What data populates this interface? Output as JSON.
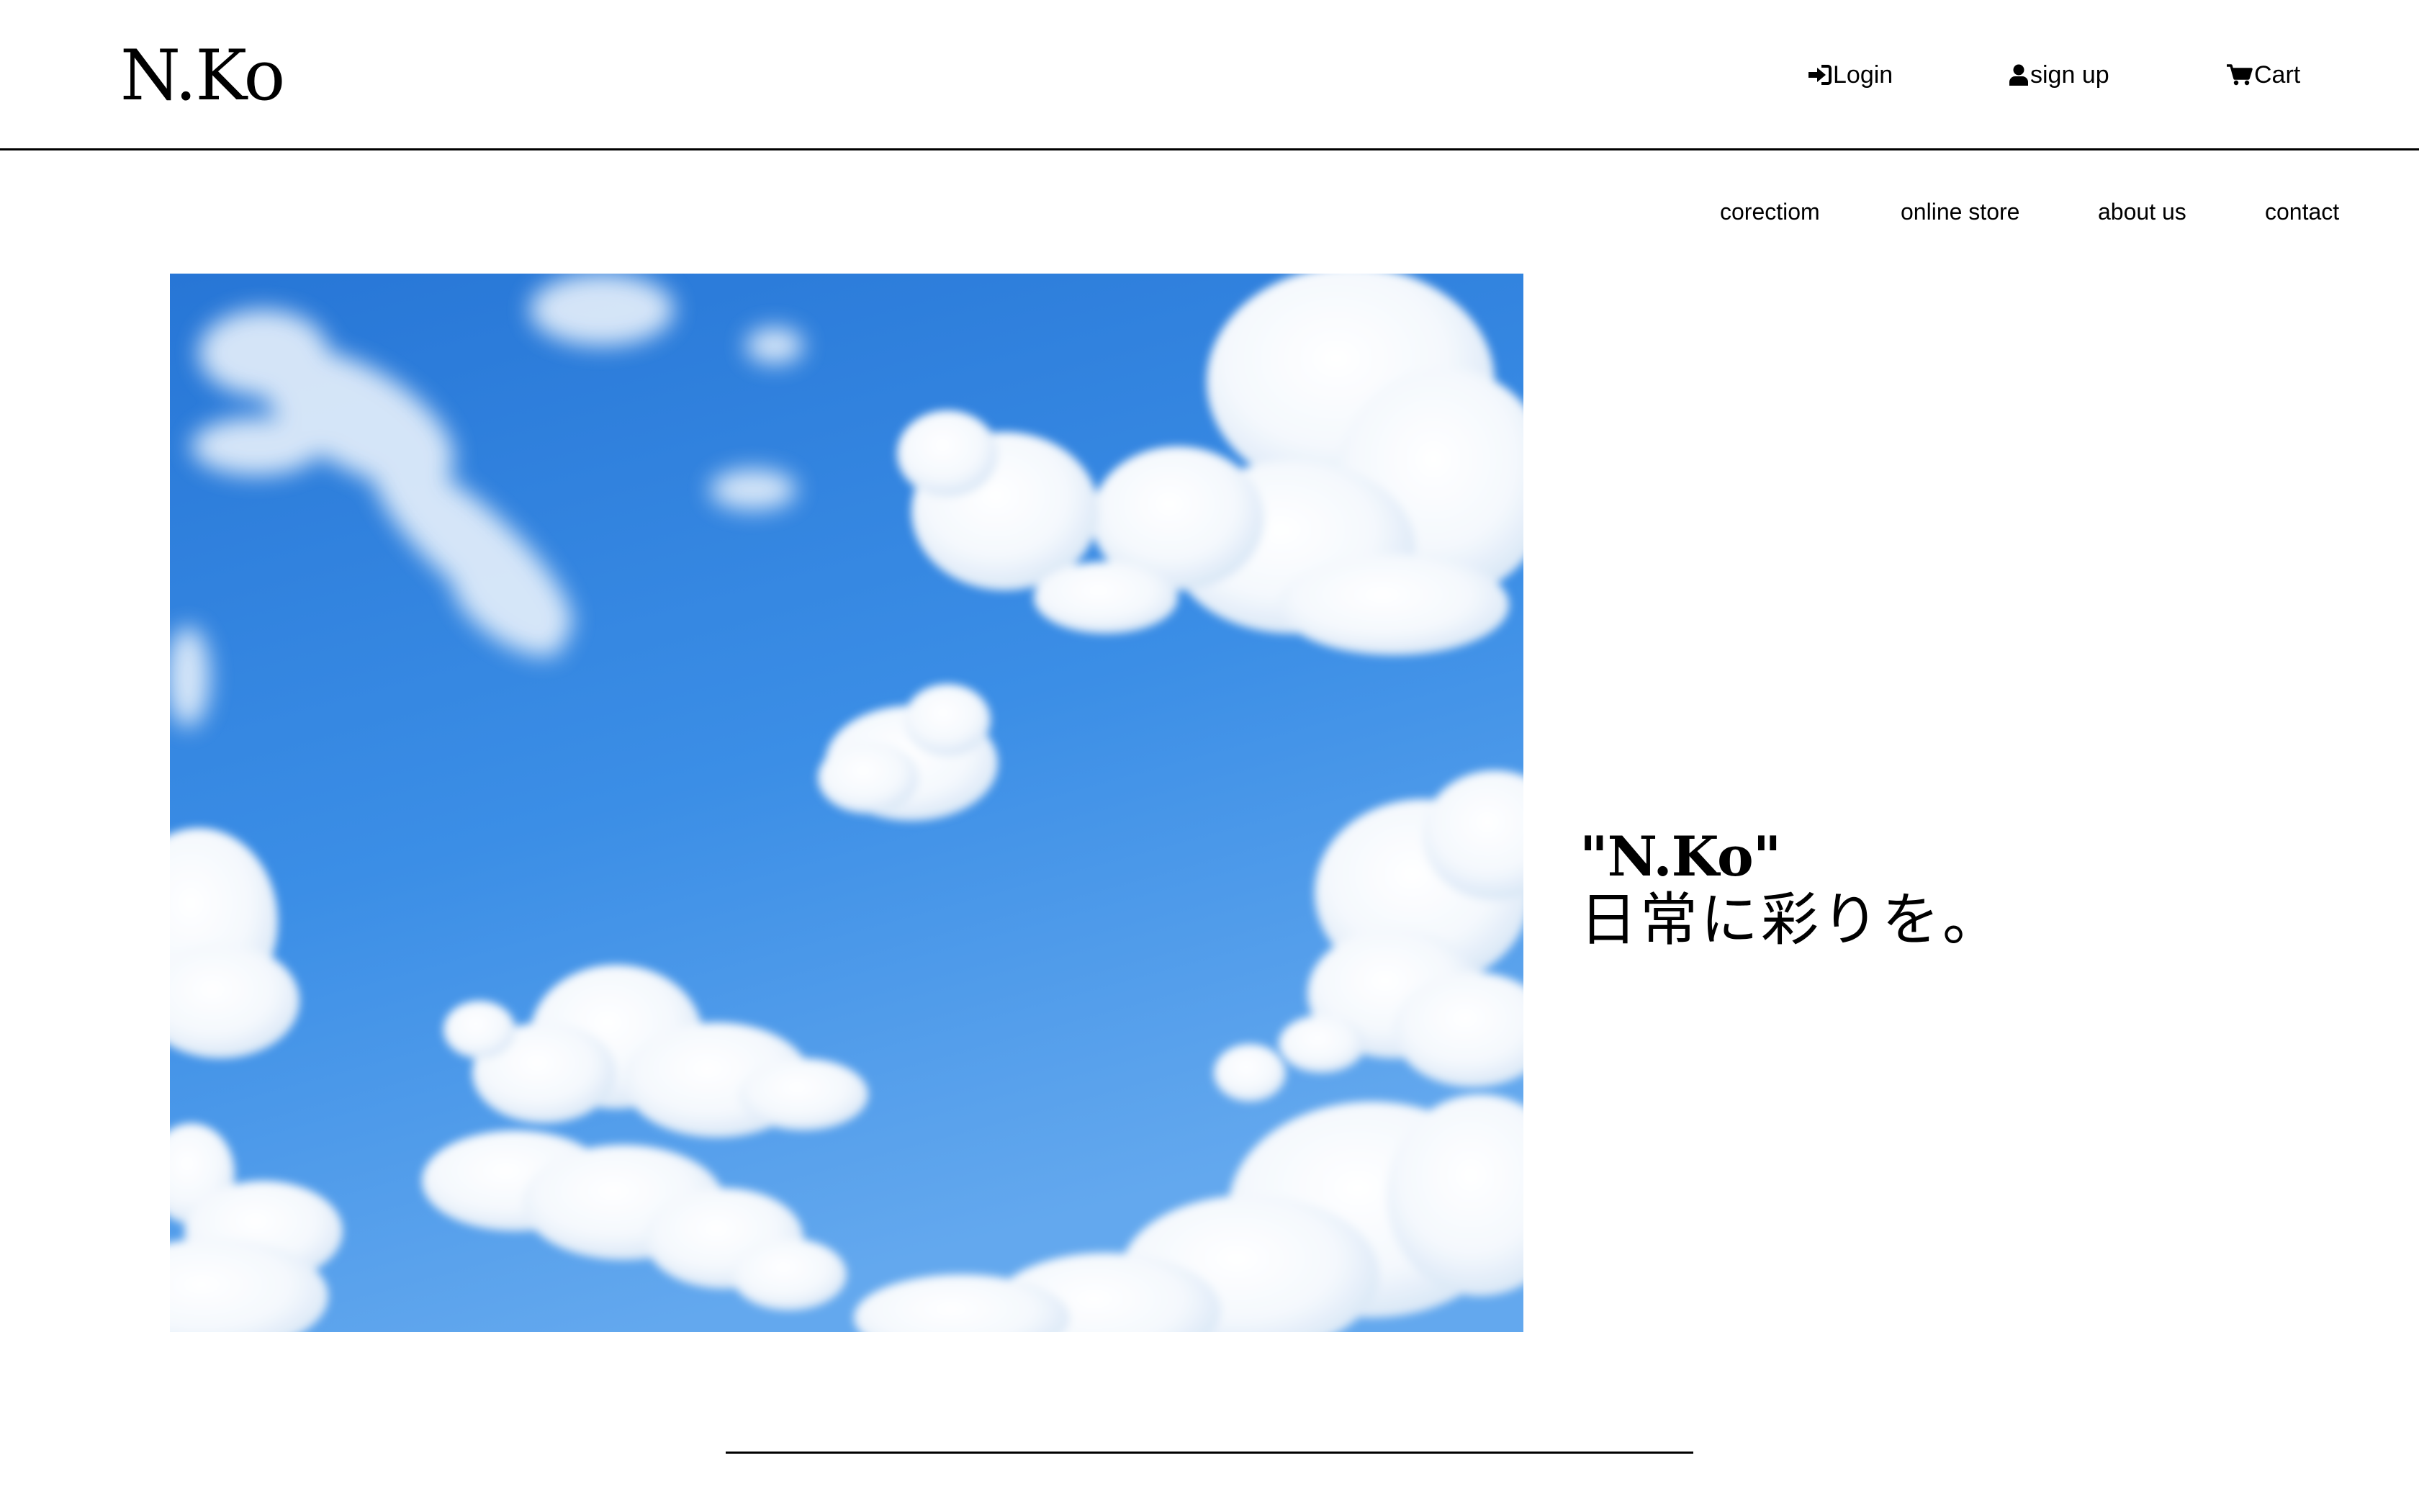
{
  "header": {
    "logo": "N.Ko",
    "account_nav": [
      {
        "label": "Login",
        "icon": "login-icon"
      },
      {
        "label": "sign up",
        "icon": "user-icon"
      },
      {
        "label": "Cart",
        "icon": "cart-icon"
      }
    ]
  },
  "main_nav": {
    "items": [
      {
        "label": "corectiom"
      },
      {
        "label": "online store"
      },
      {
        "label": "about us"
      },
      {
        "label": "contact"
      }
    ]
  },
  "hero": {
    "image": "blue-sky-clouds-photo",
    "tagline_brand": "\"N.Ko\"",
    "tagline_copy": "日常に彩りを。"
  },
  "colors": {
    "text": "#000000",
    "background": "#ffffff",
    "sky_top": "#2a7fdc",
    "sky_bottom": "#5ea3ec",
    "cloud": "#ffffff"
  }
}
